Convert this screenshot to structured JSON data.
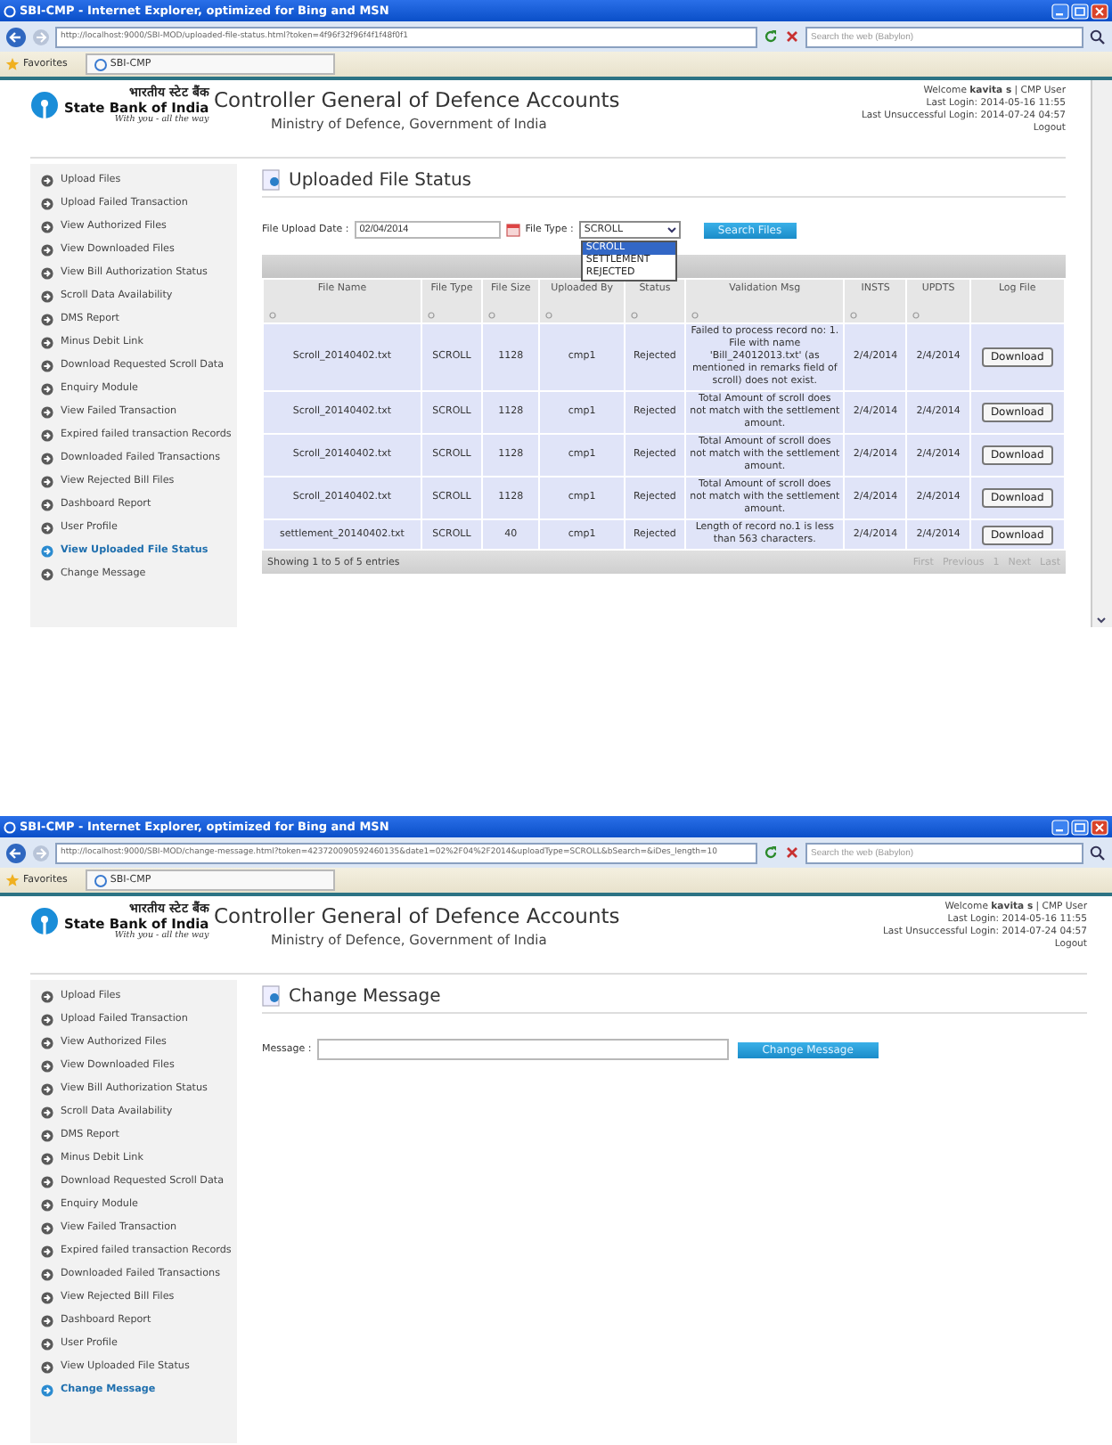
{
  "windows": [
    {
      "kind": "file-status",
      "title": "SBI-CMP - Internet Explorer, optimized for Bing and MSN",
      "url": "http://localhost:9000/SBI-MOD/uploaded-file-status.html?token=4f96f32f96f4f1f48f0f1",
      "search_placeholder": "Search the web (Babylon)",
      "favorites": "Favorites",
      "tab": "SBI-CMP",
      "scrollbar": true,
      "header": {
        "bank_hindi": "भारतीय स्टेट बैंक",
        "bank_name": "State Bank of India",
        "tagline": "With you - all the way",
        "title": "Controller General of Defence Accounts",
        "subtitle": "Ministry of Defence, Government of India",
        "welcome": "Welcome **kavita s** | CMP User",
        "last_login": "Last Login: 2014-05-16 11:55",
        "last_unsuccessful": "Last Unsuccessful Login: 2014-07-24 04:57",
        "logout": "Logout"
      },
      "sidebar": {
        "items": [
          {
            "label": "Upload Files",
            "selected": false
          },
          {
            "label": "Upload Failed Transaction",
            "selected": false
          },
          {
            "label": "View Authorized Files",
            "selected": false
          },
          {
            "label": "View Downloaded Files",
            "selected": false
          },
          {
            "label": "View Bill Authorization Status",
            "selected": false
          },
          {
            "label": "Scroll Data Availability",
            "selected": false
          },
          {
            "label": "DMS Report",
            "selected": false
          },
          {
            "label": "Minus Debit Link",
            "selected": false
          },
          {
            "label": "Download Requested Scroll Data",
            "selected": false
          },
          {
            "label": "Enquiry Module",
            "selected": false
          },
          {
            "label": "View Failed Transaction",
            "selected": false
          },
          {
            "label": "Expired failed transaction Records",
            "selected": false
          },
          {
            "label": "Downloaded Failed Transactions",
            "selected": false
          },
          {
            "label": "View Rejected Bill Files",
            "selected": false
          },
          {
            "label": "Dashboard Report",
            "selected": false
          },
          {
            "label": "User Profile",
            "selected": false
          },
          {
            "label": "View Uploaded File Status",
            "selected": true
          },
          {
            "label": "Change Message",
            "selected": false
          }
        ]
      },
      "page_title": "Uploaded File Status",
      "filters": {
        "date_label": "File Upload Date :",
        "date_value": "02/04/2014",
        "type_label": "File Type :",
        "type_value": "SCROLL",
        "type_options": [
          {
            "label": "SCROLL",
            "selected": true
          },
          {
            "label": "SETTLEMENT",
            "selected": false
          },
          {
            "label": "REJECTED",
            "selected": false
          }
        ],
        "button": "Search Files"
      },
      "table": {
        "columns": [
          "File Name",
          "File Type",
          "File Size",
          "Uploaded By",
          "Status",
          "Validation Msg",
          "INSTS",
          "UPDTS",
          "Log File"
        ],
        "sortable": [
          true,
          true,
          true,
          true,
          true,
          true,
          true,
          true,
          false
        ],
        "rows": [
          [
            "Scroll_20140402.txt",
            "SCROLL",
            "1128",
            "cmp1",
            "Rejected",
            "Failed to process record no: 1. File with name 'Bill_24012013.txt' (as mentioned in remarks field of scroll) does not exist.",
            "2/4/2014",
            "2/4/2014",
            "Download"
          ],
          [
            "Scroll_20140402.txt",
            "SCROLL",
            "1128",
            "cmp1",
            "Rejected",
            "Total Amount of scroll does not match with the settlement amount.",
            "2/4/2014",
            "2/4/2014",
            "Download"
          ],
          [
            "Scroll_20140402.txt",
            "SCROLL",
            "1128",
            "cmp1",
            "Rejected",
            "Total Amount of scroll does not match with the settlement amount.",
            "2/4/2014",
            "2/4/2014",
            "Download"
          ],
          [
            "Scroll_20140402.txt",
            "SCROLL",
            "1128",
            "cmp1",
            "Rejected",
            "Total Amount of scroll does not match with the settlement amount.",
            "2/4/2014",
            "2/4/2014",
            "Download"
          ],
          [
            "settlement_20140402.txt",
            "SCROLL",
            "40",
            "cmp1",
            "Rejected",
            "Length of record no.1 is less than 563 characters.",
            "2/4/2014",
            "2/4/2014",
            "Download"
          ]
        ],
        "info": "Showing 1 to 5 of 5 entries",
        "pager": [
          {
            "label": "First",
            "disabled": true
          },
          {
            "label": "Previous",
            "disabled": true
          },
          {
            "label": "1",
            "disabled": true
          },
          {
            "label": "Next",
            "disabled": true
          },
          {
            "label": "Last",
            "disabled": true
          }
        ]
      }
    },
    {
      "kind": "change-message",
      "title": "SBI-CMP - Internet Explorer, optimized for Bing and MSN",
      "url": "http://localhost:9000/SBI-MOD/change-message.html?token=423720090592460135&date1=02%2F04%2F2014&uploadType=SCROLL&bSearch=&iDes_length=10",
      "search_placeholder": "Search the web (Babylon)",
      "favorites": "Favorites",
      "tab": "SBI-CMP",
      "scrollbar": false,
      "header": {
        "bank_hindi": "भारतीय स्टेट बैंक",
        "bank_name": "State Bank of India",
        "tagline": "With you - all the way",
        "title": "Controller General of Defence Accounts",
        "subtitle": "Ministry of Defence, Government of India",
        "welcome": "Welcome **kavita s** | CMP User",
        "last_login": "Last Login: 2014-05-16 11:55",
        "last_unsuccessful": "Last Unsuccessful Login: 2014-07-24 04:57",
        "logout": "Logout"
      },
      "sidebar": {
        "items": [
          {
            "label": "Upload Files",
            "selected": false
          },
          {
            "label": "Upload Failed Transaction",
            "selected": false
          },
          {
            "label": "View Authorized Files",
            "selected": false
          },
          {
            "label": "View Downloaded Files",
            "selected": false
          },
          {
            "label": "View Bill Authorization Status",
            "selected": false
          },
          {
            "label": "Scroll Data Availability",
            "selected": false
          },
          {
            "label": "DMS Report",
            "selected": false
          },
          {
            "label": "Minus Debit Link",
            "selected": false
          },
          {
            "label": "Download Requested Scroll Data",
            "selected": false
          },
          {
            "label": "Enquiry Module",
            "selected": false
          },
          {
            "label": "View Failed Transaction",
            "selected": false
          },
          {
            "label": "Expired failed transaction Records",
            "selected": false
          },
          {
            "label": "Downloaded Failed Transactions",
            "selected": false
          },
          {
            "label": "View Rejected Bill Files",
            "selected": false
          },
          {
            "label": "Dashboard Report",
            "selected": false
          },
          {
            "label": "User Profile",
            "selected": false
          },
          {
            "label": "View Uploaded File Status",
            "selected": false
          },
          {
            "label": "Change Message",
            "selected": true
          }
        ]
      },
      "page_title": "Change Message",
      "form": {
        "label": "Message :",
        "button": "Change Message"
      }
    }
  ]
}
